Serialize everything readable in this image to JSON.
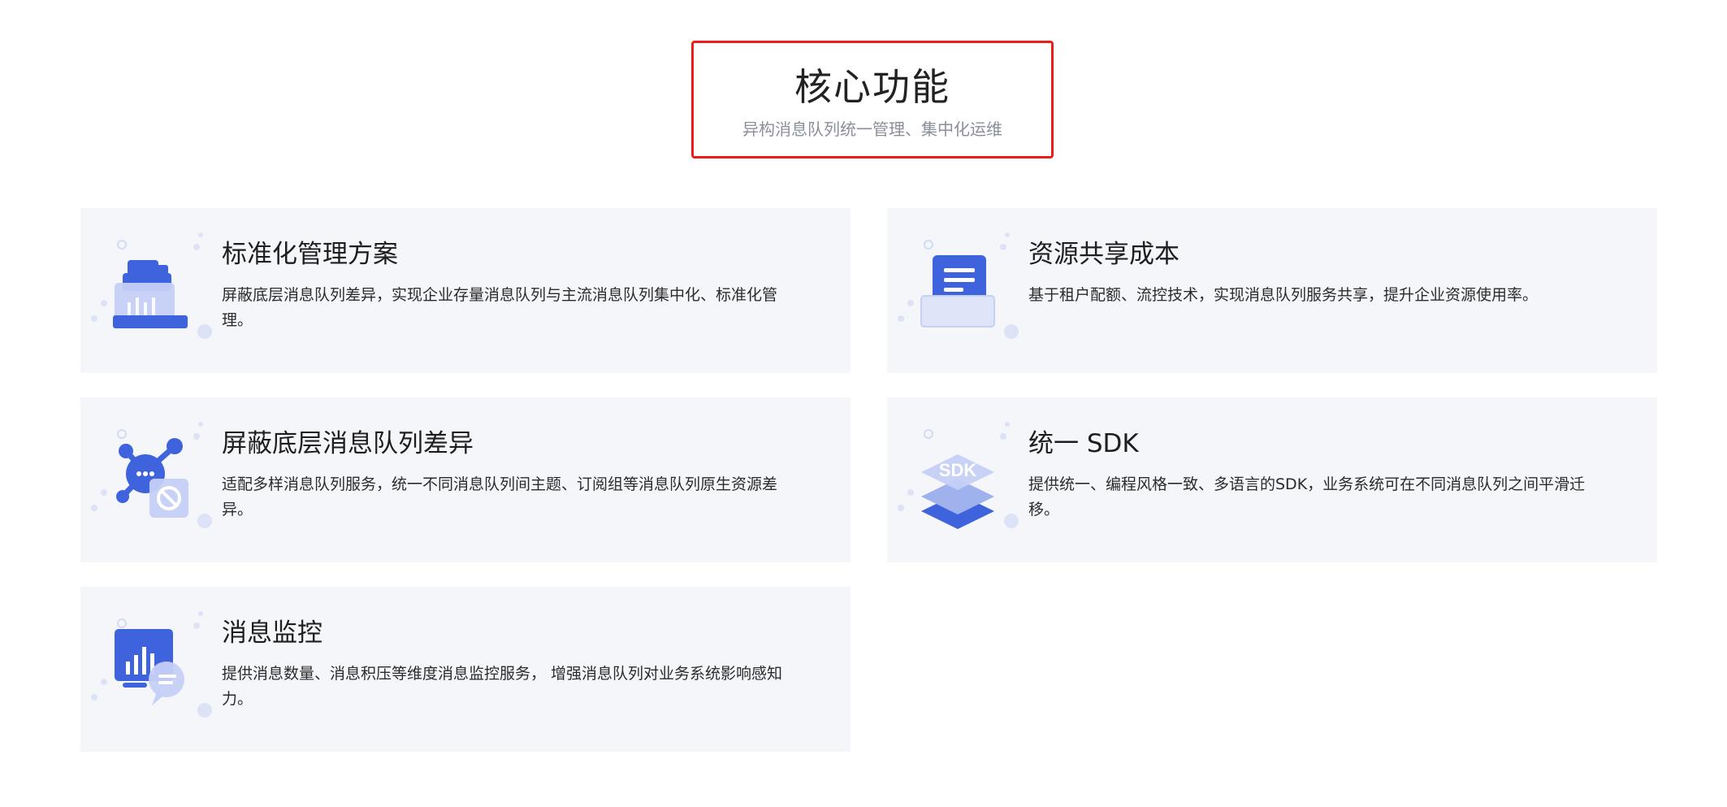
{
  "header": {
    "title": "核心功能",
    "subtitle": "异构消息队列统一管理、集中化运维"
  },
  "features": [
    {
      "icon": "database-stack-icon",
      "title": "标准化管理方案",
      "description": "屏蔽底层消息队列差异，实现企业存量消息队列与主流消息队列集中化、标准化管理。"
    },
    {
      "icon": "document-tray-icon",
      "title": "资源共享成本",
      "description": "基于租户配额、流控技术，实现消息队列服务共享，提升企业资源使用率。"
    },
    {
      "icon": "network-block-icon",
      "title": "屏蔽底层消息队列差异",
      "description": "适配多样消息队列服务，统一不同消息队列间主题、订阅组等消息队列原生资源差异。"
    },
    {
      "icon": "sdk-layers-icon",
      "icon_label": "SDK",
      "title": "统一 SDK",
      "description": "提供统一、编程风格一致、多语言的SDK，业务系统可在不同消息队列之间平滑迁移。"
    },
    {
      "icon": "monitor-chart-icon",
      "title": "消息监控",
      "description": "提供消息数量、消息积压等维度消息监控服务， 增强消息队列对业务系统影响感知力。"
    }
  ],
  "colors": {
    "accent_blue": "#3e63dd",
    "light_blue": "#c5d0f5",
    "card_bg": "#f5f6fa",
    "highlight_border": "#ee1b1b"
  }
}
